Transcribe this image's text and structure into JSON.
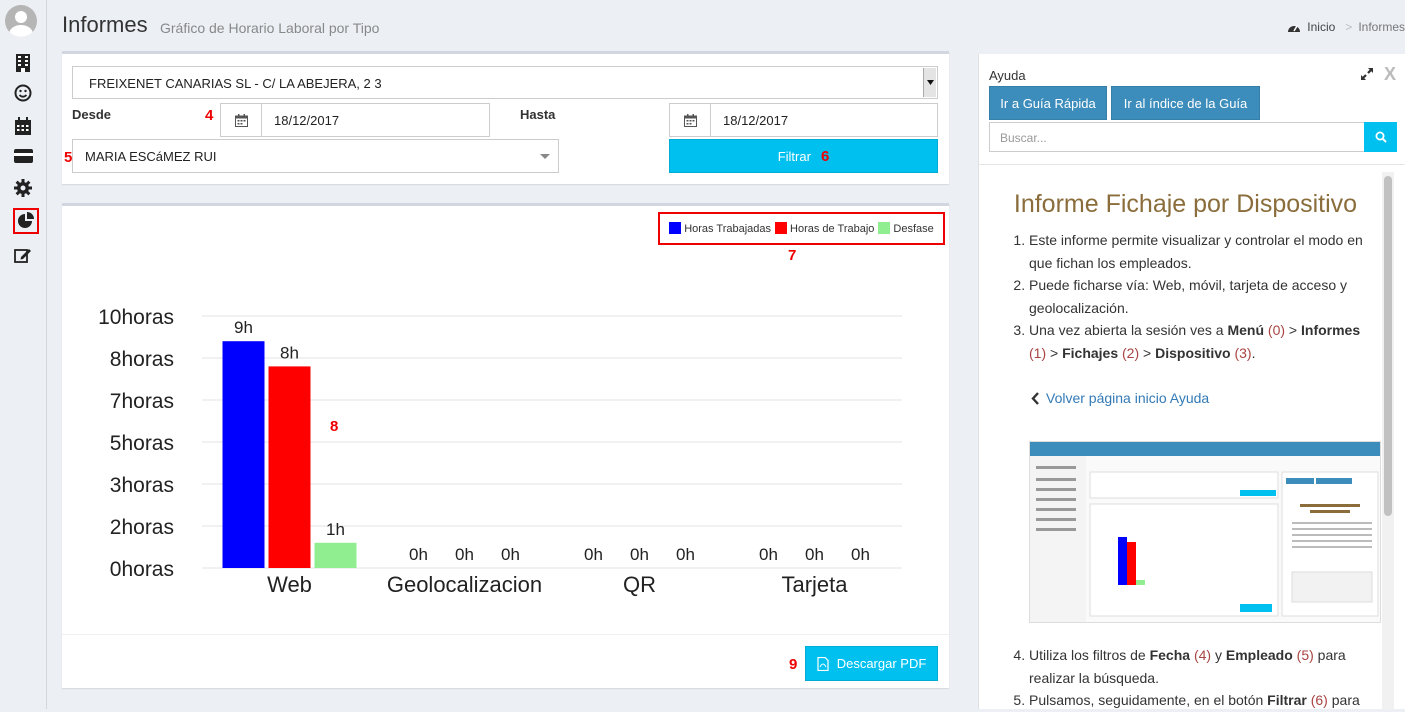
{
  "header": {
    "title": "Informes",
    "subtitle": "Gráfico de Horario Laboral por Tipo",
    "breadcrumb": [
      "Inicio",
      "Informes"
    ]
  },
  "sidebar": {
    "items": [
      {
        "icon": "building-icon"
      },
      {
        "icon": "smile-icon"
      },
      {
        "icon": "calendar-icon"
      },
      {
        "icon": "credit-card-icon"
      },
      {
        "icon": "gear-icon"
      },
      {
        "icon": "pie-chart-icon",
        "active": true
      },
      {
        "icon": "edit-icon"
      }
    ]
  },
  "filters": {
    "company": "FREIXENET CANARIAS SL - C/ LA ABEJERA, 2 3",
    "desde_label": "Desde",
    "hasta_label": "Hasta",
    "desde_value": "18/12/2017",
    "hasta_value": "18/12/2017",
    "employee": "MARIA ESCáMEZ RUI",
    "filter_button": "Filtrar"
  },
  "annotations": {
    "n4": "4",
    "n5": "5",
    "n6": "6",
    "n7": "7",
    "n8": "8",
    "n9": "9"
  },
  "legend": {
    "items": [
      {
        "label": "Horas Trabajadas",
        "color": "#0000ff"
      },
      {
        "label": "Horas de Trabajo",
        "color": "#ff0000"
      },
      {
        "label": "Desfase",
        "color": "#90ee90"
      }
    ]
  },
  "chart_data": {
    "type": "bar",
    "categories": [
      "Web",
      "Geolocalizacion",
      "QR",
      "Tarjeta"
    ],
    "series": [
      {
        "name": "Horas Trabajadas",
        "values": [
          9,
          0,
          0,
          0
        ],
        "labels": [
          "9h",
          "0h",
          "0h",
          "0h"
        ],
        "color": "#0000ff"
      },
      {
        "name": "Horas de Trabajo",
        "values": [
          8,
          0,
          0,
          0
        ],
        "labels": [
          "8h",
          "0h",
          "0h",
          "0h"
        ],
        "color": "#ff0000"
      },
      {
        "name": "Desfase",
        "values": [
          1,
          0,
          0,
          0
        ],
        "labels": [
          "1h",
          "0h",
          "0h",
          "0h"
        ],
        "color": "#90ee90"
      }
    ],
    "y_ticks": [
      "0horas",
      "2horas",
      "3horas",
      "5horas",
      "7horas",
      "8horas",
      "10horas"
    ],
    "ylim": [
      0,
      10
    ],
    "grid": true
  },
  "footer": {
    "pdf_button": "Descargar PDF"
  },
  "help": {
    "title": "Ayuda",
    "quick_guide_button": "Ir a Guía Rápida",
    "index_button": "Ir al índice de la Guía",
    "search_placeholder": "Buscar...",
    "heading": "Informe Fichaje por Dispositivo",
    "item1": "Este informe permite visualizar y controlar el modo en que fichan los empleados.",
    "item2": "Puede ficharse vía: Web, móvil, tarjeta de acceso y geolocalización.",
    "item3_a": "Una vez abierta la sesión ves a ",
    "item3_menu": "Menú",
    "item3_r0": "(0)",
    "item3_informes": "Informes",
    "item3_r1": "(1)",
    "item3_fichajes": "Fichajes",
    "item3_r2": "(2)",
    "item3_disp": "Dispositivo",
    "item3_r3": "(3)",
    "back_link": "Volver página inicio Ayuda",
    "item4_a": "Utiliza los filtros de ",
    "item4_fecha": "Fecha",
    "item4_r4": "(4)",
    "item4_y": " y ",
    "item4_empleado": "Empleado",
    "item4_r5": "(5)",
    "item4_b": " para realizar la búsqueda.",
    "item5_a": "Pulsamos, seguidamente, en el botón ",
    "item5_filtrar": "Filtrar",
    "item5_r6": "(6)",
    "item5_b": " para"
  }
}
